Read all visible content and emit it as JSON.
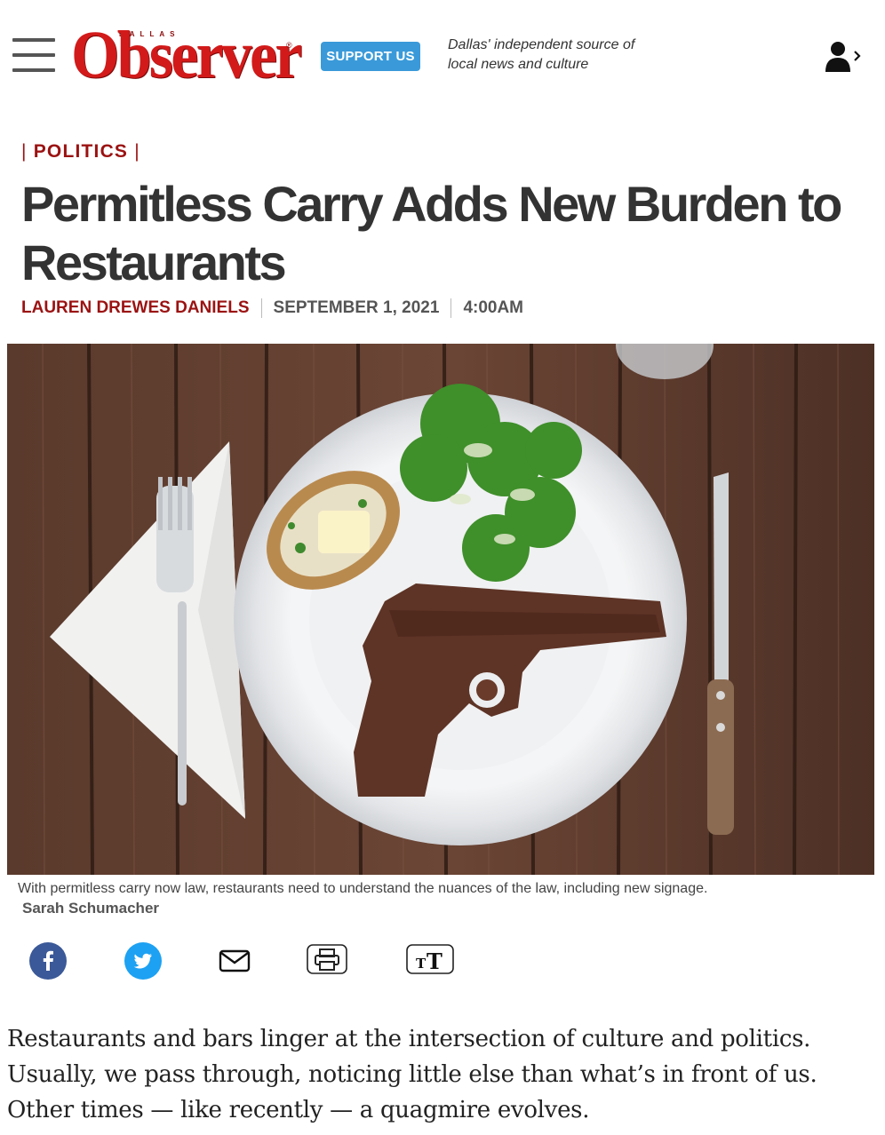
{
  "header": {
    "menu_icon": "hamburger-menu-icon",
    "logo": {
      "small": "DALLAS",
      "main": "Observer",
      "mark": "®"
    },
    "support_label": "SUPPORT US",
    "tagline": "Dallas' independent source of local news and culture",
    "user_icon": "user-account-icon"
  },
  "article": {
    "section": "POLITICS",
    "headline": "Permitless Carry Adds New Burden to Restaurants",
    "author": "LAUREN DREWES DANIELS",
    "date": "SEPTEMBER 1, 2021",
    "time": "4:00AM",
    "caption": "With permitless carry now law, restaurants need to understand the nuances of the law, including new signage.",
    "photo_credit": "Sarah Schumacher",
    "body": "Restaurants and bars linger at the intersection of culture and politics. Usually, we pass through, noticing little else than what’s in front of us. Other times — like recently — a quagmire evolves."
  },
  "share": {
    "icons": [
      "facebook-icon",
      "twitter-icon",
      "email-icon",
      "print-icon",
      "text-size-icon"
    ]
  },
  "colors": {
    "brand_red": "#d31a1a",
    "section_red": "#9b1212",
    "support_blue": "#3a9ad9",
    "facebook_blue": "#3b5998",
    "twitter_blue": "#1da1f2"
  }
}
